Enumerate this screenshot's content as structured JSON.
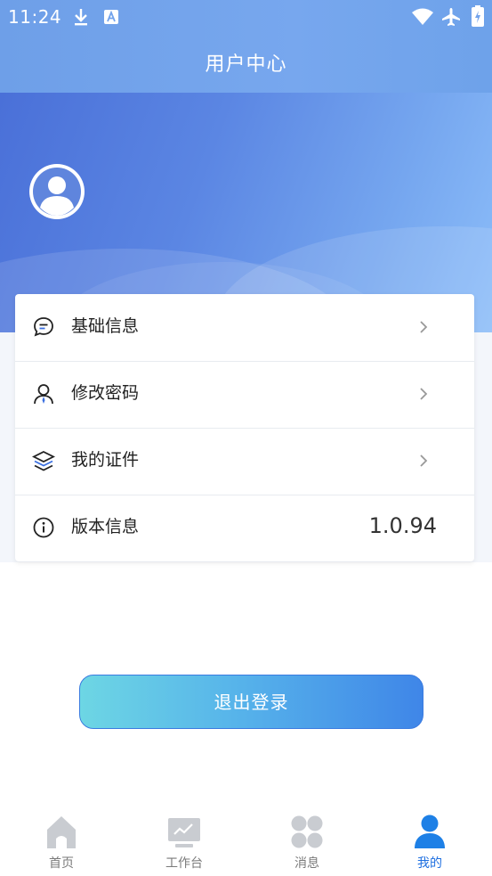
{
  "status_bar": {
    "time": "11:24"
  },
  "header": {
    "title": "用户中心"
  },
  "menu": {
    "items": [
      {
        "label": "基础信息",
        "icon": "chat-bubble-icon"
      },
      {
        "label": "修改密码",
        "icon": "user-key-icon"
      },
      {
        "label": "我的证件",
        "icon": "layers-icon"
      },
      {
        "label": "版本信息",
        "icon": "info-icon",
        "value": "1.0.94"
      }
    ]
  },
  "logout": {
    "label": "退出登录"
  },
  "tabbar": {
    "tabs": [
      {
        "label": "首页",
        "icon": "home-icon"
      },
      {
        "label": "工作台",
        "icon": "workbench-icon"
      },
      {
        "label": "消息",
        "icon": "message-grid-icon"
      },
      {
        "label": "我的",
        "icon": "user-icon",
        "active": true
      }
    ]
  },
  "colors": {
    "accent": "#1e6fe0",
    "header": "#72a3ec"
  }
}
